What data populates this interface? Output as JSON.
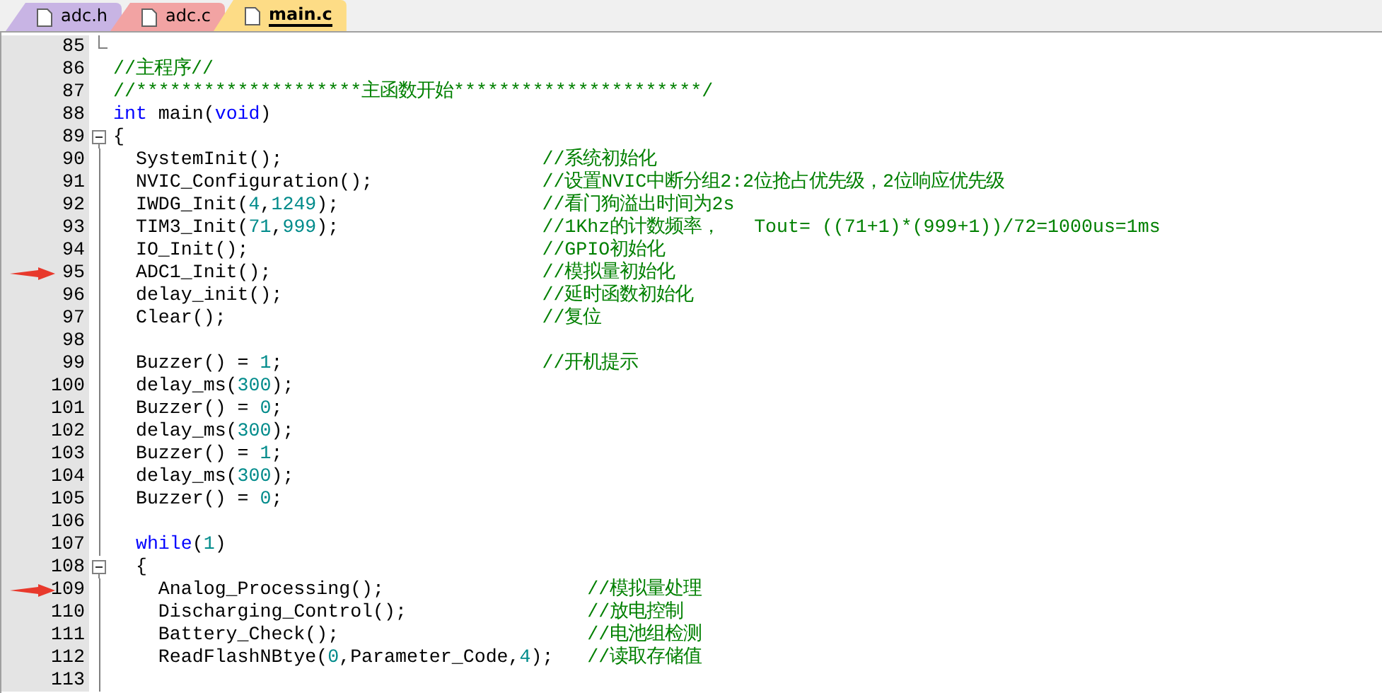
{
  "tabs": [
    {
      "label": "adc.h",
      "color": "#c8b4e4",
      "selected": false
    },
    {
      "label": "adc.c",
      "color": "#f2a3a3",
      "selected": false
    },
    {
      "label": "main.c",
      "color": "#fddc86",
      "selected": true
    }
  ],
  "lines": [
    {
      "number": "85",
      "collapsible": false,
      "arrow": false
    },
    {
      "number": "86",
      "collapsible": false,
      "arrow": false,
      "segments": [
        {
          "kind": "comment",
          "text": "//主程序//"
        }
      ]
    },
    {
      "number": "87",
      "collapsible": false,
      "arrow": false,
      "segments": [
        {
          "kind": "comment",
          "text": "//********************主函数开始**********************/"
        }
      ]
    },
    {
      "number": "88",
      "collapsible": false,
      "arrow": false,
      "segments": [
        {
          "kind": "keyword",
          "text": "int"
        },
        {
          "kind": "plain",
          "text": " main("
        },
        {
          "kind": "keyword",
          "text": "void"
        },
        {
          "kind": "plain",
          "text": ")"
        }
      ]
    },
    {
      "number": "89",
      "collapsible": true,
      "arrow": false,
      "segments": [
        {
          "kind": "plain",
          "text": "{"
        }
      ]
    },
    {
      "number": "90",
      "collapsible": false,
      "arrow": false,
      "segments": [
        {
          "kind": "plain",
          "text": "  SystemInit();                       "
        },
        {
          "kind": "comment",
          "text": "//系统初始化"
        }
      ]
    },
    {
      "number": "91",
      "collapsible": false,
      "arrow": false,
      "segments": [
        {
          "kind": "plain",
          "text": "  NVIC_Configuration();               "
        },
        {
          "kind": "comment",
          "text": "//设置NVIC中断分组2:2位抢占优先级，2位响应优先级"
        }
      ]
    },
    {
      "number": "92",
      "collapsible": false,
      "arrow": false,
      "segments": [
        {
          "kind": "plain",
          "text": "  IWDG_Init("
        },
        {
          "kind": "number",
          "text": "4"
        },
        {
          "kind": "plain",
          "text": ","
        },
        {
          "kind": "number",
          "text": "1249"
        },
        {
          "kind": "plain",
          "text": ");                  "
        },
        {
          "kind": "comment",
          "text": "//看门狗溢出时间为2s"
        }
      ]
    },
    {
      "number": "93",
      "collapsible": false,
      "arrow": false,
      "segments": [
        {
          "kind": "plain",
          "text": "  TIM3_Init("
        },
        {
          "kind": "number",
          "text": "71"
        },
        {
          "kind": "plain",
          "text": ","
        },
        {
          "kind": "number",
          "text": "999"
        },
        {
          "kind": "plain",
          "text": ");                  "
        },
        {
          "kind": "comment",
          "text": "//1Khz的计数频率，   Tout= ((71+1)*(999+1))/72=1000us=1ms"
        }
      ]
    },
    {
      "number": "94",
      "collapsible": false,
      "arrow": false,
      "segments": [
        {
          "kind": "plain",
          "text": "  IO_Init();                          "
        },
        {
          "kind": "comment",
          "text": "//GPIO初始化"
        }
      ]
    },
    {
      "number": "95",
      "collapsible": false,
      "arrow": true,
      "segments": [
        {
          "kind": "plain",
          "text": "  ADC1_Init();                        "
        },
        {
          "kind": "comment",
          "text": "//模拟量初始化"
        }
      ]
    },
    {
      "number": "96",
      "collapsible": false,
      "arrow": false,
      "segments": [
        {
          "kind": "plain",
          "text": "  delay_init();                       "
        },
        {
          "kind": "comment",
          "text": "//延时函数初始化"
        }
      ]
    },
    {
      "number": "97",
      "collapsible": false,
      "arrow": false,
      "segments": [
        {
          "kind": "plain",
          "text": "  Clear();                            "
        },
        {
          "kind": "comment",
          "text": "//复位"
        }
      ]
    },
    {
      "number": "98",
      "collapsible": false,
      "arrow": false
    },
    {
      "number": "99",
      "collapsible": false,
      "arrow": false,
      "segments": [
        {
          "kind": "plain",
          "text": "  Buzzer() = "
        },
        {
          "kind": "number",
          "text": "1"
        },
        {
          "kind": "plain",
          "text": ";                       "
        },
        {
          "kind": "comment",
          "text": "//开机提示"
        }
      ]
    },
    {
      "number": "100",
      "collapsible": false,
      "arrow": false,
      "segments": [
        {
          "kind": "plain",
          "text": "  delay_ms("
        },
        {
          "kind": "number",
          "text": "300"
        },
        {
          "kind": "plain",
          "text": ");"
        }
      ]
    },
    {
      "number": "101",
      "collapsible": false,
      "arrow": false,
      "segments": [
        {
          "kind": "plain",
          "text": "  Buzzer() = "
        },
        {
          "kind": "number",
          "text": "0"
        },
        {
          "kind": "plain",
          "text": ";"
        }
      ]
    },
    {
      "number": "102",
      "collapsible": false,
      "arrow": false,
      "segments": [
        {
          "kind": "plain",
          "text": "  delay_ms("
        },
        {
          "kind": "number",
          "text": "300"
        },
        {
          "kind": "plain",
          "text": ");"
        }
      ]
    },
    {
      "number": "103",
      "collapsible": false,
      "arrow": false,
      "segments": [
        {
          "kind": "plain",
          "text": "  Buzzer() = "
        },
        {
          "kind": "number",
          "text": "1"
        },
        {
          "kind": "plain",
          "text": ";"
        }
      ]
    },
    {
      "number": "104",
      "collapsible": false,
      "arrow": false,
      "segments": [
        {
          "kind": "plain",
          "text": "  delay_ms("
        },
        {
          "kind": "number",
          "text": "300"
        },
        {
          "kind": "plain",
          "text": ");"
        }
      ]
    },
    {
      "number": "105",
      "collapsible": false,
      "arrow": false,
      "segments": [
        {
          "kind": "plain",
          "text": "  Buzzer() = "
        },
        {
          "kind": "number",
          "text": "0"
        },
        {
          "kind": "plain",
          "text": ";"
        }
      ]
    },
    {
      "number": "106",
      "collapsible": false,
      "arrow": false
    },
    {
      "number": "107",
      "collapsible": false,
      "arrow": false,
      "segments": [
        {
          "kind": "keyword",
          "text": "  while"
        },
        {
          "kind": "plain",
          "text": "("
        },
        {
          "kind": "number",
          "text": "1"
        },
        {
          "kind": "plain",
          "text": ")"
        }
      ]
    },
    {
      "number": "108",
      "collapsible": true,
      "arrow": false,
      "segments": [
        {
          "kind": "plain",
          "text": "  {"
        }
      ]
    },
    {
      "number": "109",
      "collapsible": false,
      "arrow": true,
      "segments": [
        {
          "kind": "plain",
          "text": "    Analog_Processing();                  "
        },
        {
          "kind": "comment",
          "text": "//模拟量处理"
        }
      ]
    },
    {
      "number": "110",
      "collapsible": false,
      "arrow": false,
      "segments": [
        {
          "kind": "plain",
          "text": "    Discharging_Control();                "
        },
        {
          "kind": "comment",
          "text": "//放电控制"
        }
      ]
    },
    {
      "number": "111",
      "collapsible": false,
      "arrow": false,
      "segments": [
        {
          "kind": "plain",
          "text": "    Battery_Check();                      "
        },
        {
          "kind": "comment",
          "text": "//电池组检测"
        }
      ]
    },
    {
      "number": "112",
      "collapsible": false,
      "arrow": false,
      "segments": [
        {
          "kind": "plain",
          "text": "    ReadFlashNBtye("
        },
        {
          "kind": "number",
          "text": "0"
        },
        {
          "kind": "plain",
          "text": ",Parameter_Code,"
        },
        {
          "kind": "number",
          "text": "4"
        },
        {
          "kind": "plain",
          "text": ");   "
        },
        {
          "kind": "comment",
          "text": "//读取存储值"
        }
      ]
    },
    {
      "number": "113",
      "collapsible": false,
      "arrow": false
    }
  ]
}
